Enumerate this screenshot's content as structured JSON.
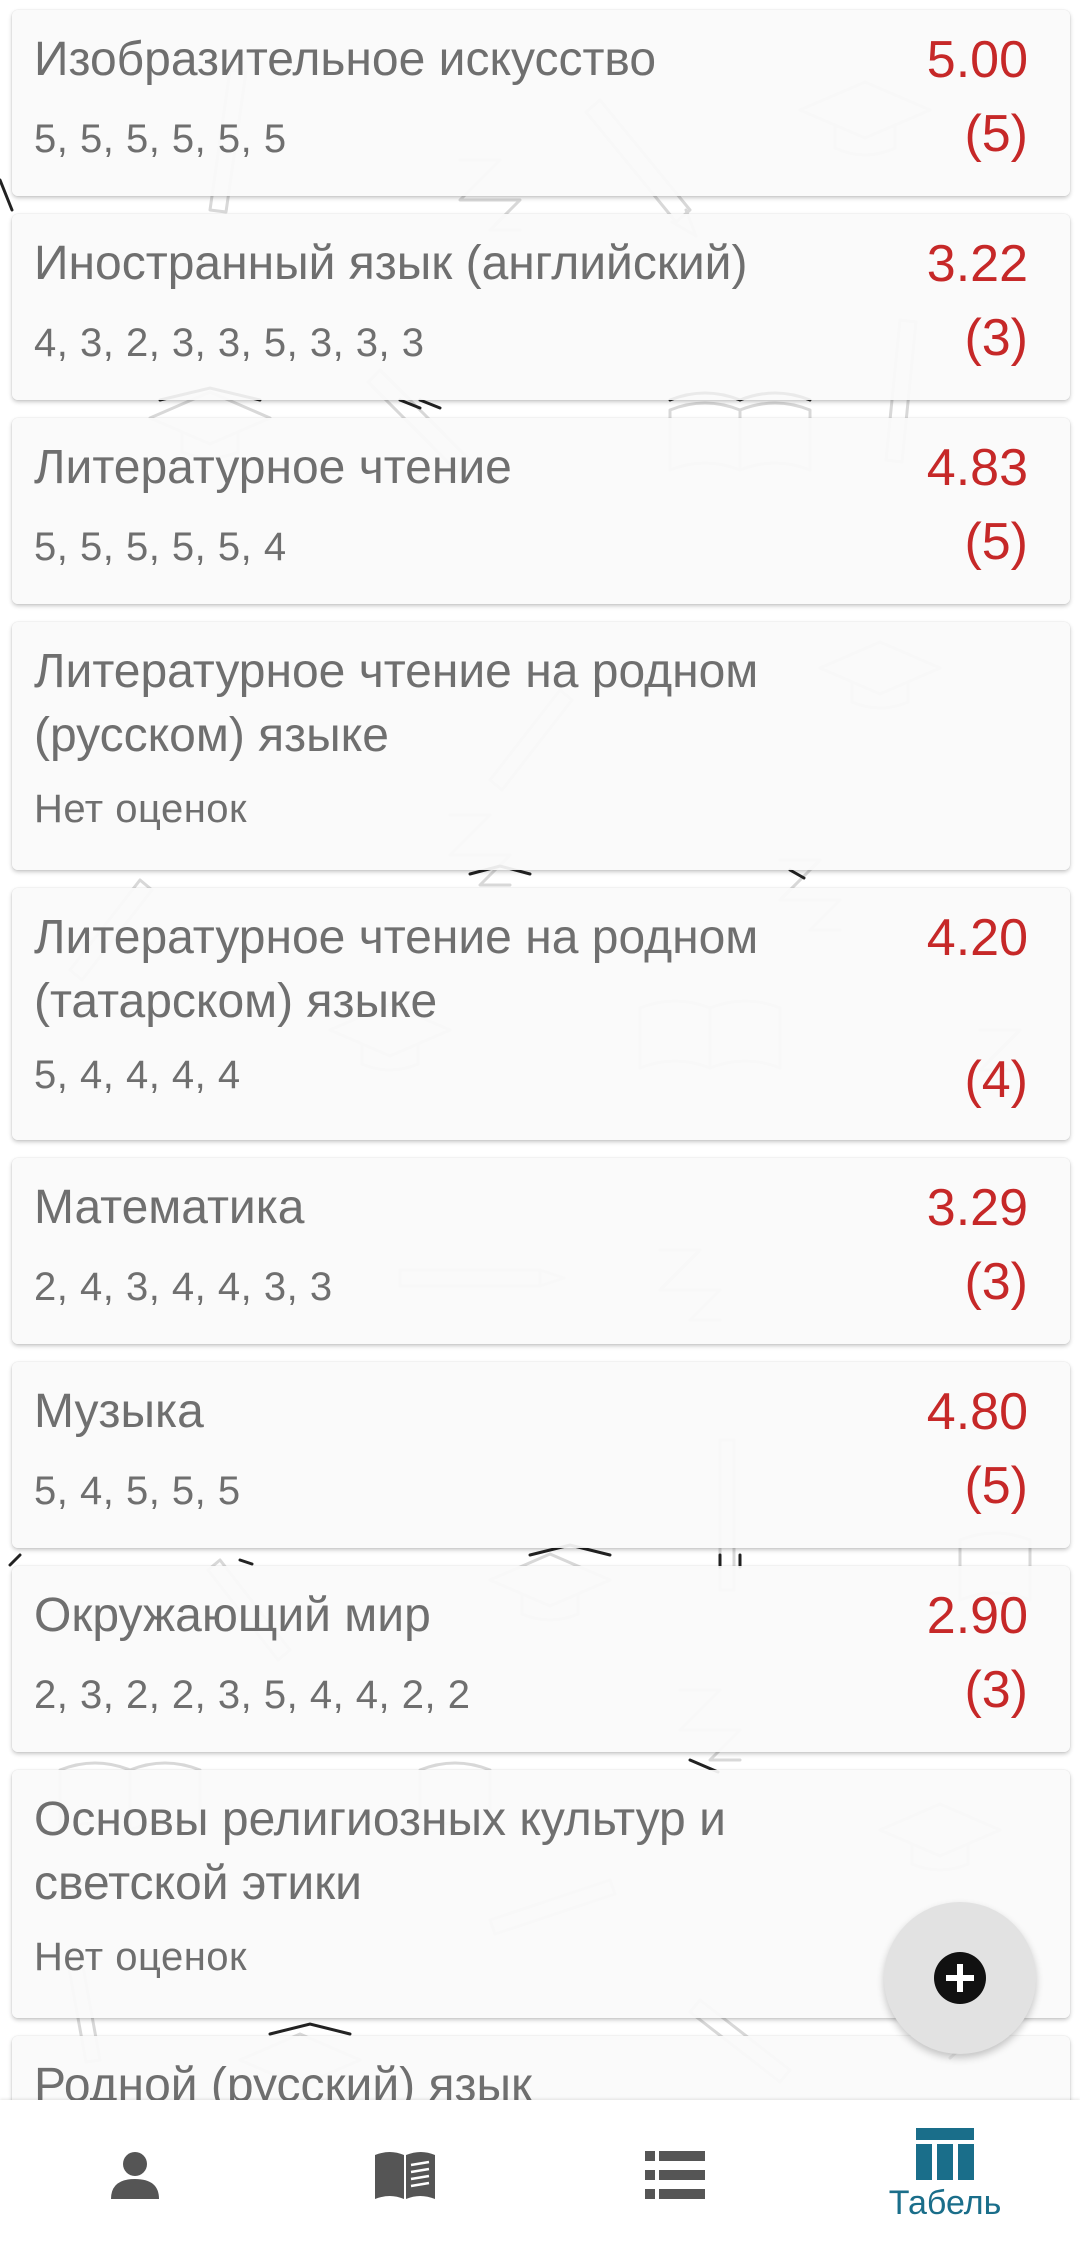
{
  "subjects": [
    {
      "name": "Изобразительное искусство",
      "grades": "5, 5, 5, 5, 5, 5",
      "average": "5.00",
      "final": "(5)"
    },
    {
      "name": "Иностранный язык (английский)",
      "grades": "4, 3, 2, 3, 3, 5, 3, 3, 3",
      "average": "3.22",
      "final": "(3)"
    },
    {
      "name": "Литературное чтение",
      "grades": "5, 5, 5, 5, 5, 4",
      "average": "4.83",
      "final": "(5)"
    },
    {
      "name": "Литературное чтение на родном (русском) языке",
      "grades": "Нет оценок",
      "average": "",
      "final": ""
    },
    {
      "name": "Литературное чтение на родном (татарском) языке",
      "grades": "5, 4, 4, 4, 4",
      "average": "4.20",
      "final": "(4)"
    },
    {
      "name": "Математика",
      "grades": "2, 4, 3, 4, 4, 3, 3",
      "average": "3.29",
      "final": "(3)"
    },
    {
      "name": "Музыка",
      "grades": "5, 4, 5, 5, 5",
      "average": "4.80",
      "final": "(5)"
    },
    {
      "name": "Окружающий мир",
      "grades": "2, 3, 2, 2, 3, 5, 4, 4, 2, 2",
      "average": "2.90",
      "final": "(3)"
    },
    {
      "name": "Основы религиозных культур и светской этики",
      "grades": "Нет оценок",
      "average": "",
      "final": ""
    },
    {
      "name": "Родной (русский) язык",
      "grades": "",
      "average": "",
      "final": ""
    }
  ],
  "fab": {
    "icon": "plus-circle-icon"
  },
  "bottom_nav": {
    "items": [
      {
        "icon": "person-icon",
        "label": ""
      },
      {
        "icon": "book-icon",
        "label": ""
      },
      {
        "icon": "list-icon",
        "label": ""
      },
      {
        "icon": "table-icon",
        "label": "Табель",
        "active": true
      }
    ]
  },
  "colors": {
    "grade_red": "#c62828",
    "text_gray": "#6f6f6f",
    "nav_active": "#1a6e8a",
    "nav_inactive": "#555555"
  }
}
